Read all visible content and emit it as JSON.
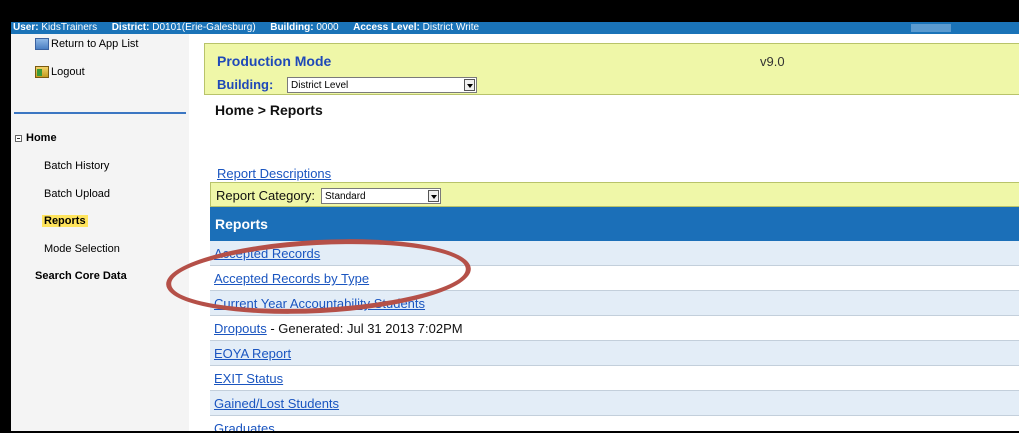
{
  "topbar": {
    "user_label": "User:",
    "user_value": "KidsTrainers",
    "district_label": "District:",
    "district_value": "D0101(Erie-Galesburg)",
    "building_label": "Building:",
    "building_value": "0000",
    "access_label": "Access Level:",
    "access_value": "District Write"
  },
  "sidebar": {
    "return_link": "Return to App List",
    "logout_link": "Logout",
    "home_label": "Home",
    "items": [
      {
        "label": "Batch History"
      },
      {
        "label": "Batch Upload"
      },
      {
        "label": "Reports"
      },
      {
        "label": "Mode Selection"
      }
    ],
    "core_data_label": "Search Core Data"
  },
  "header": {
    "mode_title": "Production Mode",
    "version": "v9.0",
    "building_label": "Building:",
    "building_select": "District Level"
  },
  "breadcrumb": "Home > Reports",
  "report_descriptions_link": "Report Descriptions",
  "category": {
    "label": "Report Category:",
    "selected": "Standard"
  },
  "reports": {
    "heading": "Reports",
    "rows": [
      {
        "label": "Accepted Records",
        "extra": ""
      },
      {
        "label": "Accepted Records by Type",
        "extra": ""
      },
      {
        "label": "Current Year Accountability Students",
        "extra": ""
      },
      {
        "label": "Dropouts",
        "extra": " - Generated: Jul 31 2013 7:02PM"
      },
      {
        "label": "EOYA Report",
        "extra": ""
      },
      {
        "label": "EXIT Status",
        "extra": ""
      },
      {
        "label": "Gained/Lost Students",
        "extra": ""
      },
      {
        "label": "Graduates",
        "extra": ""
      }
    ]
  },
  "colors": {
    "topbar": "#1a73b8",
    "header_panel": "#eff7a8",
    "table_header": "#1b6fb8",
    "link": "#1a55c0",
    "annotation_circle": "#b55048",
    "active_nav_highlight": "#ffe45c"
  },
  "icons": {
    "return": "return-app-icon",
    "logout": "logout-icon",
    "home_toggle": "collapse-minus-icon"
  }
}
